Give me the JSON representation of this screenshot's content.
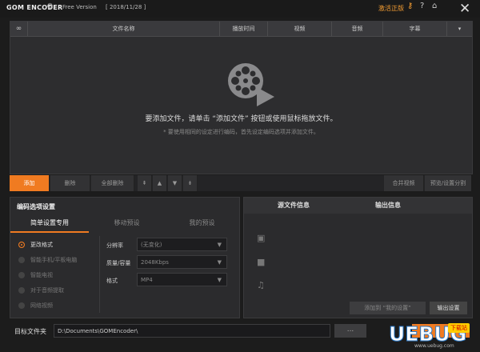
{
  "titlebar": {
    "logo": "GOM ENCODER",
    "version": "Free Version",
    "build": "[ 2018/11/28 ]",
    "activate": "激活正版",
    "icons": [
      "gear-icon",
      "key-icon",
      "help-icon",
      "home-icon",
      "close-icon"
    ]
  },
  "filelist": {
    "columns": [
      "文件名称",
      "播放时间",
      "视频",
      "音频",
      "字幕"
    ],
    "empty_title": "要添加文件，请单击 “添加文件” 按钮或使用鼠标拖放文件。",
    "empty_hint": "* 要使用相同的设定进行编码，首先设定编码选项并添加文件。"
  },
  "toolbar": {
    "add": "添加",
    "remove": "删除",
    "remove_all": "全部删除",
    "merge_video": "合并视频",
    "preview_settings": "预览/设置分割"
  },
  "options": {
    "title": "编码选项设置",
    "tabs": [
      "简单设置专用",
      "移动预设",
      "我的预设"
    ],
    "radios": [
      {
        "label": "更改格式",
        "selected": true
      },
      {
        "label": "智能手机/平板电脑",
        "selected": false
      },
      {
        "label": "智能电视",
        "selected": false
      },
      {
        "label": "对于音频提取",
        "selected": false
      },
      {
        "label": "网络视频",
        "selected": false
      }
    ],
    "fields": [
      {
        "label": "分辨率",
        "value": "(无变化)"
      },
      {
        "label": "质量/容量",
        "value": "2048Kbps"
      },
      {
        "label": "格式",
        "value": "MP4"
      }
    ]
  },
  "info": {
    "source_tab": "源文件信息",
    "output_tab": "输出信息",
    "add_preset": "添加到 “我的设置”",
    "output_settings": "输出设置"
  },
  "destination": {
    "label": "目标文件夹",
    "path": "D:\\Documents\\GOMEncoder\\",
    "browse": "..."
  },
  "watermark": {
    "brand": "UEBUG",
    "badge": "下载站",
    "site": "www.uebug.com"
  },
  "colors": {
    "accent": "#f07b21",
    "activate": "#f39c32"
  }
}
